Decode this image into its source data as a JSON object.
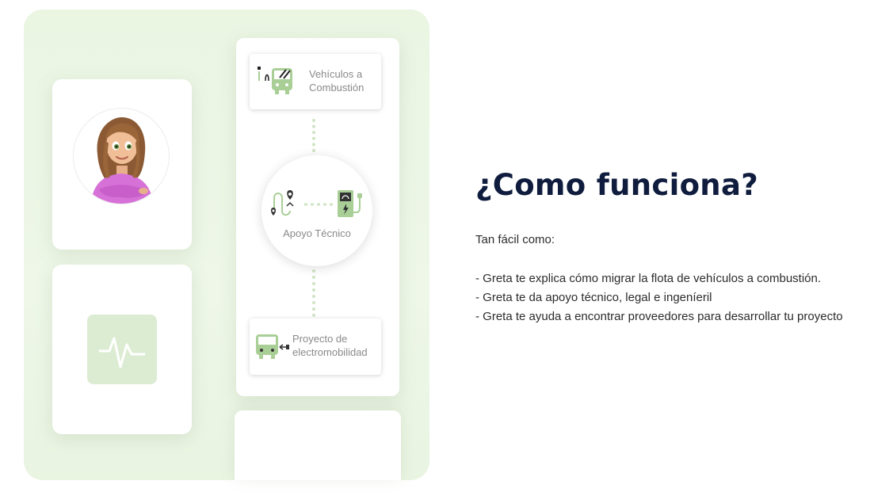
{
  "feature_panel": {
    "steps": {
      "top_label_line1": "Vehículos a",
      "top_label_line2": "Combustión",
      "middle_label": "Apoyo Técnico",
      "bottom_label_line1": "Proyecto de",
      "bottom_label_line2": "electromobilidad"
    },
    "icons": {
      "avatar": "woman-avatar",
      "pulse": "pulse-icon",
      "combustion": "combustion-bus-icon",
      "route": "route-icon",
      "charger": "ev-charger-icon",
      "electric": "electric-bus-icon"
    },
    "colors": {
      "panel_bg": "#eaf5e2",
      "accent_green": "#a9cf97",
      "dots": "#cfe4c4"
    }
  },
  "content": {
    "heading": "¿Como funciona?",
    "intro": "Tan fácil como:",
    "bullets": [
      "- Greta te explica cómo migrar la flota de vehículos a combustión.",
      "- Greta te da apoyo técnico, legal e ingeníeril",
      "- Greta te ayuda a encontrar proveedores para desarrollar tu proyecto"
    ]
  }
}
